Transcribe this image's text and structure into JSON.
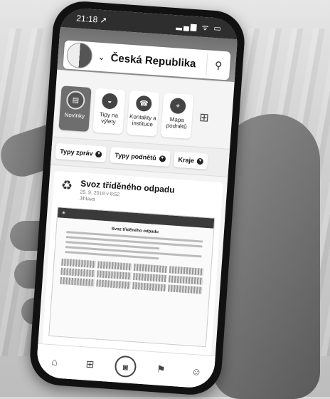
{
  "status": {
    "time": "21:18 ➚",
    "icons": "▂▄▆ ᯤ ▭"
  },
  "header": {
    "region": "Česká Republika",
    "chevron_icon": "chevron-down-icon",
    "search_icon": "search-icon"
  },
  "tiles": [
    {
      "label": "Novinky",
      "icon": "news-icon",
      "active": true
    },
    {
      "label": "Tipy na výlety",
      "icon": "backpack-icon",
      "active": false
    },
    {
      "label": "Kontakty a instituce",
      "icon": "phone-icon",
      "active": false
    },
    {
      "label": "Mapa podnětů",
      "icon": "map-pin-icon",
      "active": false
    }
  ],
  "filters": [
    {
      "label": "Typy zpráv"
    },
    {
      "label": "Typy podnětů"
    },
    {
      "label": "Kraje"
    }
  ],
  "card": {
    "title": "Svoz tříděného odpadu",
    "meta1": "25. 9. 2018 v 8:52",
    "meta2": "Jihlava",
    "doc_title": "Svoz tříděného odpadu"
  },
  "tabbar": [
    {
      "icon": "home-icon"
    },
    {
      "icon": "grid-icon"
    },
    {
      "icon": "camera-icon"
    },
    {
      "icon": "notifications-icon"
    },
    {
      "icon": "profile-icon"
    }
  ]
}
